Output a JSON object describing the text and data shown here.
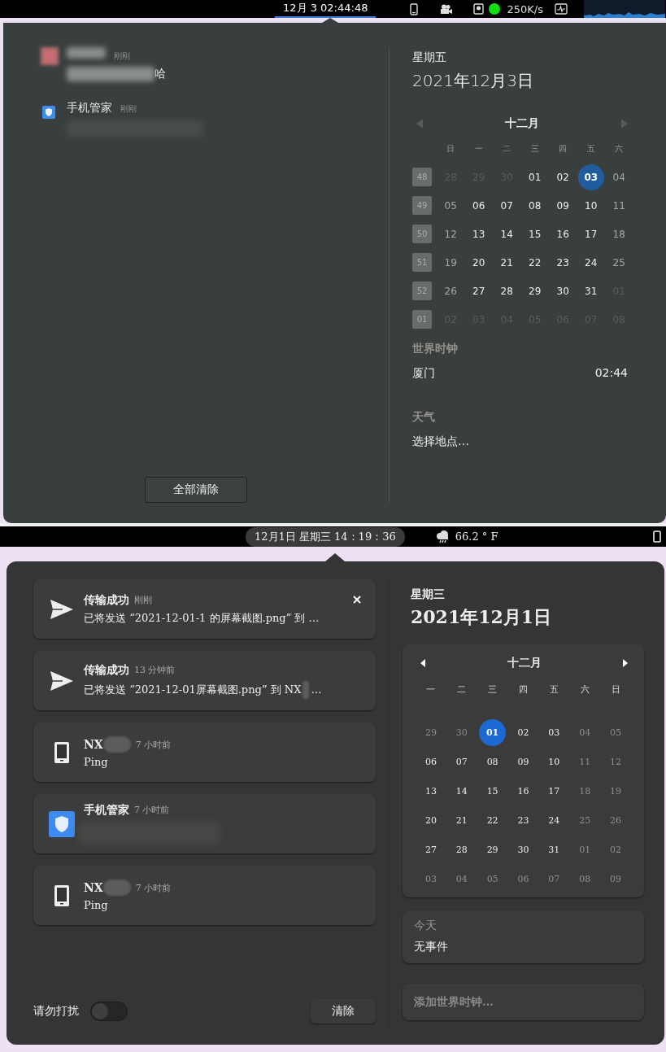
{
  "top_bar": {
    "clock": {
      "text": "12月 3  02:44:48",
      "selected": true
    },
    "net_speed": "250K/s"
  },
  "popover_1": {
    "notifications": [
      {
        "kind": "chat",
        "time": "刚刚",
        "body": "哈"
      },
      {
        "kind": "app",
        "title": "手机管家",
        "time": "刚刚"
      }
    ],
    "clear_button": "全部清除",
    "calendar": {
      "weekday": "星期五",
      "date": "2021年12月3日",
      "month": "十二月",
      "weekdays": [
        "日",
        "一",
        "二",
        "三",
        "四",
        "五",
        "六"
      ],
      "weeks": [
        {
          "number": "48",
          "days": [
            {
              "n": "28",
              "kind": "other",
              "selected": false
            },
            {
              "n": "29",
              "kind": "other",
              "selected": false
            },
            {
              "n": "30",
              "kind": "other",
              "selected": false
            },
            {
              "n": "01",
              "kind": "weekday",
              "selected": false
            },
            {
              "n": "02",
              "kind": "weekday",
              "selected": false
            },
            {
              "n": "03",
              "kind": "weekday",
              "selected": true
            },
            {
              "n": "04",
              "kind": "weekend",
              "selected": false
            }
          ]
        },
        {
          "number": "49",
          "days": [
            {
              "n": "05",
              "kind": "weekend",
              "selected": false
            },
            {
              "n": "06",
              "kind": "weekday",
              "selected": false
            },
            {
              "n": "07",
              "kind": "weekday",
              "selected": false
            },
            {
              "n": "08",
              "kind": "weekday",
              "selected": false
            },
            {
              "n": "09",
              "kind": "weekday",
              "selected": false
            },
            {
              "n": "10",
              "kind": "weekday",
              "selected": false
            },
            {
              "n": "11",
              "kind": "weekend",
              "selected": false
            }
          ]
        },
        {
          "number": "50",
          "days": [
            {
              "n": "12",
              "kind": "weekend",
              "selected": false
            },
            {
              "n": "13",
              "kind": "weekday",
              "selected": false
            },
            {
              "n": "14",
              "kind": "weekday",
              "selected": false
            },
            {
              "n": "15",
              "kind": "weekday",
              "selected": false
            },
            {
              "n": "16",
              "kind": "weekday",
              "selected": false
            },
            {
              "n": "17",
              "kind": "weekday",
              "selected": false
            },
            {
              "n": "18",
              "kind": "weekend",
              "selected": false
            }
          ]
        },
        {
          "number": "51",
          "days": [
            {
              "n": "19",
              "kind": "weekend",
              "selected": false
            },
            {
              "n": "20",
              "kind": "weekday",
              "selected": false
            },
            {
              "n": "21",
              "kind": "weekday",
              "selected": false
            },
            {
              "n": "22",
              "kind": "weekday",
              "selected": false
            },
            {
              "n": "23",
              "kind": "weekday",
              "selected": false
            },
            {
              "n": "24",
              "kind": "weekday",
              "selected": false
            },
            {
              "n": "25",
              "kind": "weekend",
              "selected": false
            }
          ]
        },
        {
          "number": "52",
          "days": [
            {
              "n": "26",
              "kind": "weekend",
              "selected": false
            },
            {
              "n": "27",
              "kind": "weekday",
              "selected": false
            },
            {
              "n": "28",
              "kind": "weekday",
              "selected": false
            },
            {
              "n": "29",
              "kind": "weekday",
              "selected": false
            },
            {
              "n": "30",
              "kind": "weekday",
              "selected": false
            },
            {
              "n": "31",
              "kind": "weekday",
              "selected": false
            },
            {
              "n": "01",
              "kind": "other",
              "selected": false
            }
          ]
        },
        {
          "number": "01",
          "days": [
            {
              "n": "02",
              "kind": "other",
              "selected": false
            },
            {
              "n": "03",
              "kind": "other",
              "selected": false
            },
            {
              "n": "04",
              "kind": "other",
              "selected": false
            },
            {
              "n": "05",
              "kind": "other",
              "selected": false
            },
            {
              "n": "06",
              "kind": "other",
              "selected": false
            },
            {
              "n": "07",
              "kind": "other",
              "selected": false
            },
            {
              "n": "08",
              "kind": "other",
              "selected": false
            }
          ]
        }
      ]
    },
    "world_clock": {
      "heading": "世界时钟",
      "city": "厦门",
      "time": "02:44"
    },
    "weather": {
      "heading": "天气",
      "location": "选择地点…"
    }
  },
  "bottom_bar": {
    "clock": "12月1日 星期三 14：19：36",
    "temperature": "66.2 ° F"
  },
  "popover_2": {
    "notifications": [
      {
        "kind": "transfer",
        "title": "传输成功",
        "time": "刚刚",
        "body": "已将发送 “2021-12-01-1 的屏幕截图.png” 到 …",
        "closable": true
      },
      {
        "kind": "transfer",
        "title": "传输成功",
        "time": "13 分钟前",
        "body": "已将发送 “2021-12-01屏幕截图.png” 到 NX",
        "body_redacted": true,
        "body_end": "…",
        "closable": false
      },
      {
        "kind": "device",
        "title": "NX",
        "title_redacted": true,
        "time": "7 小时前",
        "body": "Ping",
        "closable": false
      },
      {
        "kind": "app",
        "title": "手机管家",
        "time": "7 小时前",
        "body_redacted": true,
        "closable": false
      },
      {
        "kind": "device",
        "title": "NX",
        "title_redacted": true,
        "time": "7 小时前",
        "body": "Ping",
        "closable": false
      }
    ],
    "do_not_disturb": {
      "label": "请勿打扰",
      "on": false
    },
    "clear_button": "清除",
    "calendar": {
      "weekday": "星期三",
      "date": "2021年12月1日",
      "month": "十二月",
      "weekdays": [
        "一",
        "二",
        "三",
        "四",
        "五",
        "六",
        "日"
      ],
      "weeks": [
        [
          {
            "n": "29",
            "kind": "other",
            "selected": false
          },
          {
            "n": "30",
            "kind": "other",
            "selected": false
          },
          {
            "n": "01",
            "kind": "weekday",
            "selected": true
          },
          {
            "n": "02",
            "kind": "weekday",
            "selected": false
          },
          {
            "n": "03",
            "kind": "weekday",
            "selected": false
          },
          {
            "n": "04",
            "kind": "weekend",
            "selected": false
          },
          {
            "n": "05",
            "kind": "weekend",
            "selected": false
          }
        ],
        [
          {
            "n": "06",
            "kind": "weekday",
            "selected": false
          },
          {
            "n": "07",
            "kind": "weekday",
            "selected": false
          },
          {
            "n": "08",
            "kind": "weekday",
            "selected": false
          },
          {
            "n": "09",
            "kind": "weekday",
            "selected": false
          },
          {
            "n": "10",
            "kind": "weekday",
            "selected": false
          },
          {
            "n": "11",
            "kind": "weekend",
            "selected": false
          },
          {
            "n": "12",
            "kind": "weekend",
            "selected": false
          }
        ],
        [
          {
            "n": "13",
            "kind": "weekday",
            "selected": false
          },
          {
            "n": "14",
            "kind": "weekday",
            "selected": false
          },
          {
            "n": "15",
            "kind": "weekday",
            "selected": false
          },
          {
            "n": "16",
            "kind": "weekday",
            "selected": false
          },
          {
            "n": "17",
            "kind": "weekday",
            "selected": false
          },
          {
            "n": "18",
            "kind": "weekend",
            "selected": false
          },
          {
            "n": "19",
            "kind": "weekend",
            "selected": false
          }
        ],
        [
          {
            "n": "20",
            "kind": "weekday",
            "selected": false
          },
          {
            "n": "21",
            "kind": "weekday",
            "selected": false
          },
          {
            "n": "22",
            "kind": "weekday",
            "selected": false
          },
          {
            "n": "23",
            "kind": "weekday",
            "selected": false
          },
          {
            "n": "24",
            "kind": "weekday",
            "selected": false
          },
          {
            "n": "25",
            "kind": "weekend",
            "selected": false
          },
          {
            "n": "26",
            "kind": "weekend",
            "selected": false
          }
        ],
        [
          {
            "n": "27",
            "kind": "weekday",
            "selected": false
          },
          {
            "n": "28",
            "kind": "weekday",
            "selected": false
          },
          {
            "n": "29",
            "kind": "weekday",
            "selected": false
          },
          {
            "n": "30",
            "kind": "weekday",
            "selected": false
          },
          {
            "n": "31",
            "kind": "weekday",
            "selected": false
          },
          {
            "n": "01",
            "kind": "other",
            "selected": false
          },
          {
            "n": "02",
            "kind": "other",
            "selected": false
          }
        ],
        [
          {
            "n": "03",
            "kind": "other",
            "selected": false
          },
          {
            "n": "04",
            "kind": "other",
            "selected": false
          },
          {
            "n": "05",
            "kind": "other",
            "selected": false
          },
          {
            "n": "06",
            "kind": "other",
            "selected": false
          },
          {
            "n": "07",
            "kind": "other",
            "selected": false
          },
          {
            "n": "08",
            "kind": "other",
            "selected": false
          },
          {
            "n": "09",
            "kind": "other",
            "selected": false
          }
        ]
      ]
    },
    "today": {
      "heading": "今天",
      "body": "无事件"
    },
    "add_world_clock": "添加世界时钟…"
  }
}
